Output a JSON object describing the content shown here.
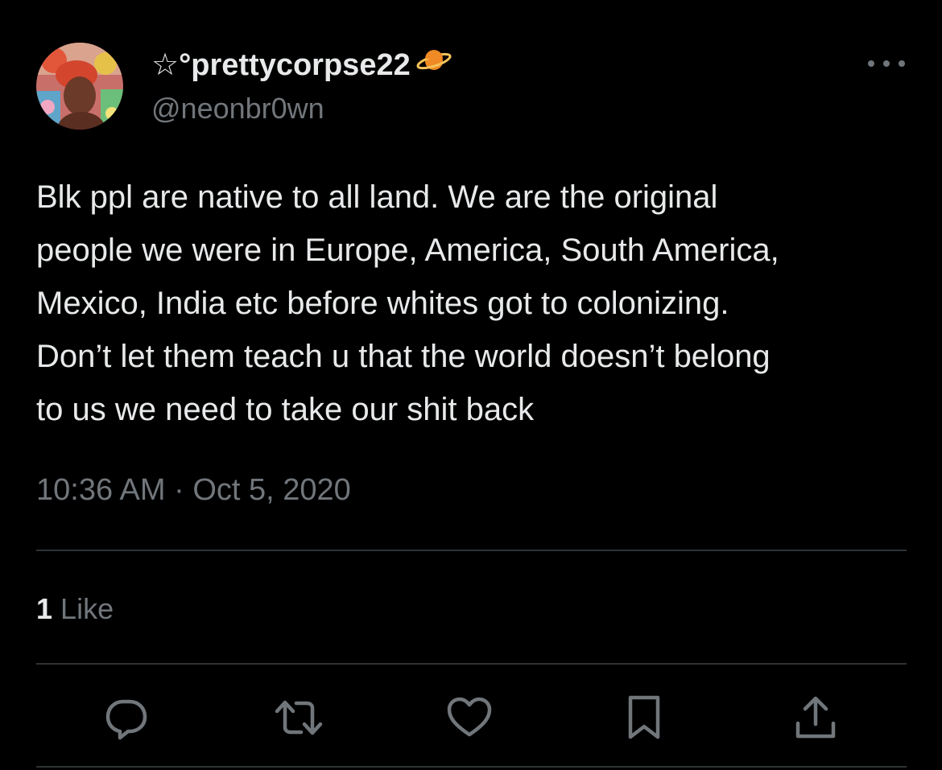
{
  "tweet": {
    "display_name": "☆°prettycorpse22",
    "handle": "@neonbr0wn",
    "text_lines": [
      "Blk ppl are native to all land. We are the original",
      "people we were in Europe, America, South America,",
      "Mexico, India etc before whites got to colonizing.",
      "Don’t let them teach u that the world doesn’t belong",
      "to us we need to take our shit back"
    ],
    "timestamp": "10:36 AM · Oct 5, 2020",
    "like_count": "1",
    "like_label": "Like"
  },
  "icons": {
    "name_emoji": "ringed-planet-icon",
    "more": "more-options-icon",
    "actions": [
      "reply-icon",
      "retweet-icon",
      "like-icon",
      "bookmark-icon",
      "share-icon"
    ]
  },
  "colors": {
    "background": "#000000",
    "primary_text": "#e7e9ea",
    "secondary_text": "#71767b",
    "divider": "#2f3336"
  }
}
